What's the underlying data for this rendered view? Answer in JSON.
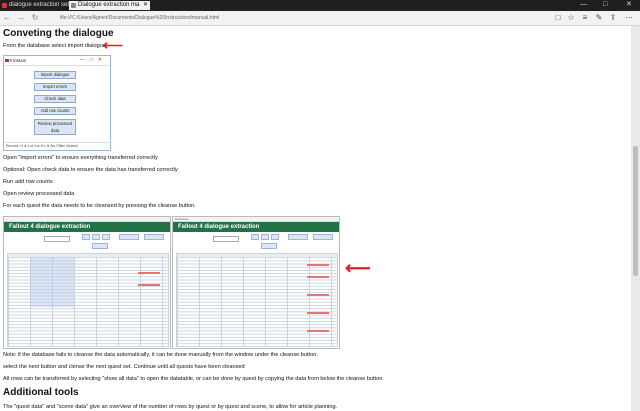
{
  "browser": {
    "tabs": [
      {
        "label": "dialogue extraction setup",
        "active": false
      },
      {
        "label": "Dialogue extraction ma",
        "active": true
      }
    ],
    "url": "file:///C:/Users/Agneri/Documents/Dialogue%20Instructions/manual.html",
    "controls": {
      "minimize": "—",
      "maximize": "□",
      "close": "✕",
      "back": "←",
      "forward": "→",
      "refresh": "↻",
      "reading": "□",
      "favorite": "☆",
      "hub": "≡",
      "notes": "✎",
      "share": "⇪",
      "more": "⋯"
    }
  },
  "page": {
    "heading1": "Conveting the dialogue",
    "intro": "From the database select import dialogue",
    "access_window": {
      "title": "frmMain",
      "buttons": [
        "Import dialogue",
        "Import errors",
        "Check data",
        "Add row counts",
        "Review processed data"
      ],
      "record_nav": "Record: H  ◂ 1 of 1  ▸ H ▹∗   No Filter   Search"
    },
    "steps": [
      "Open \"Import errors\" to ensure everything transferred correctly",
      "Optional: Open check data to ensure the data has transferred correctly",
      "Run add row counts",
      "Open review processed data",
      "For each quest the data needs to be cleansed by pressing the cleanse button."
    ],
    "screenshots": [
      {
        "titlebar": "",
        "banner": "Fallout 4 dialogue extraction"
      },
      {
        "titlebar": "frmreview",
        "banner": "Fallout 4 dialogue extraction"
      }
    ],
    "notes": [
      "Note: if the database fails to cleanse the data automatically, it can be done manually from the window under the cleanse button.",
      "select the next button and clense the next quest set. Continue until all quests have been cleansed",
      "All rows can be transferred by selecting \"show all data\" to open the datatable, or can be done by quest by copying the data from below the cleanse button."
    ],
    "heading2": "Additional tools",
    "tools_text": "The \"quest data\" and \"scene data\" give an overview of the number of rows by quest or by quest and scene, to allow for article planning."
  },
  "colors": {
    "banner": "#217346",
    "arrow": "#e0202a"
  }
}
